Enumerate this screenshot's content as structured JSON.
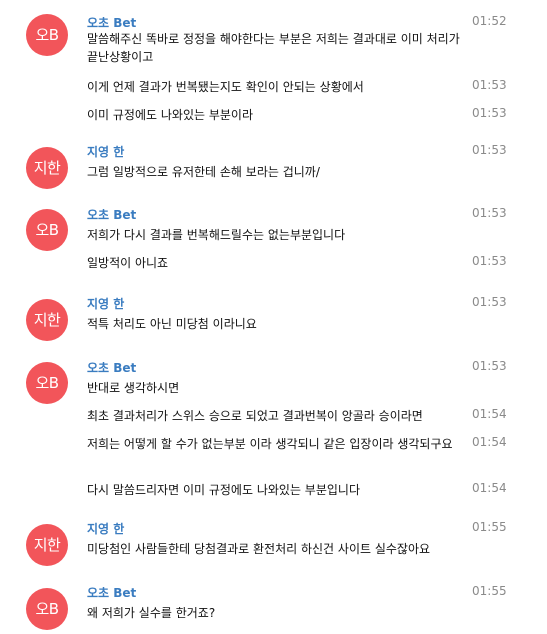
{
  "colors": {
    "avatar_bg": "#f2555a",
    "sender_name": "#3a7cc0",
    "timestamp": "#8a8a8a"
  },
  "messages": [
    {
      "avatar": "오B",
      "sender": "오초 Bet",
      "time": "01:52",
      "lines": [
        {
          "text": "말씀해주신 똑바로 정정을 해야한다는 부분은 저희는 결과대로 이미 처리가 끝난상황이고",
          "time": ""
        },
        {
          "text": "이게 언제 결과가 번복됐는지도 확인이 안되는 상황에서",
          "time": "01:53"
        },
        {
          "text": "이미 규정에도 나와있는 부분이라",
          "time": "01:53"
        }
      ]
    },
    {
      "avatar": "지한",
      "sender": "지영 한",
      "time": "01:53",
      "lines": [
        {
          "text": "그럼 일방적으로 유저한테 손해 보라는 겁니까/",
          "time": ""
        }
      ]
    },
    {
      "avatar": "오B",
      "sender": "오초 Bet",
      "time": "01:53",
      "lines": [
        {
          "text": "저희가 다시 결과를 번복해드릴수는 없는부분입니다",
          "time": ""
        },
        {
          "text": "일방적이 아니죠",
          "time": "01:53"
        }
      ]
    },
    {
      "avatar": "지한",
      "sender": "지영 한",
      "time": "01:53",
      "lines": [
        {
          "text": "적특 처리도 아닌 미당첨 이라니요",
          "time": ""
        }
      ]
    },
    {
      "avatar": "오B",
      "sender": "오초 Bet",
      "time": "01:53",
      "lines": [
        {
          "text": "반대로 생각하시면",
          "time": ""
        },
        {
          "text": "최초 결과처리가 스위스 승으로 되었고 결과번복이 앙골라 승이라면",
          "time": "01:54"
        },
        {
          "text": "저희는 어떻게 할 수가 없는부분 이라 생각되니 같은 입장이라 생각되구요",
          "time": "01:54"
        },
        {
          "text": "다시 말씀드리자면 이미 규정에도 나와있는 부분입니다",
          "time": "01:54"
        }
      ]
    },
    {
      "avatar": "지한",
      "sender": "지영 한",
      "time": "01:55",
      "lines": [
        {
          "text": "미당첨인 사람들한테 당첨결과로 환전처리 하신건 사이트 실수잖아요",
          "time": ""
        }
      ]
    },
    {
      "avatar": "오B",
      "sender": "오초 Bet",
      "time": "01:55",
      "lines": [
        {
          "text": "왜 저희가 실수를 한거죠?",
          "time": ""
        }
      ]
    }
  ]
}
